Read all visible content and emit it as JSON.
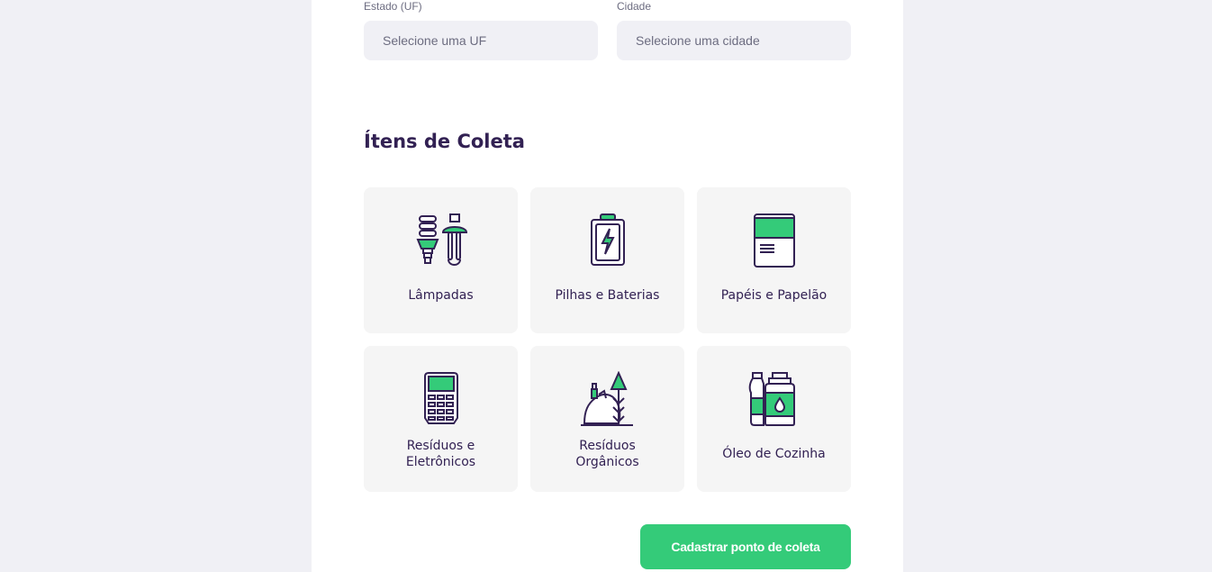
{
  "form": {
    "uf_label": "Estado (UF)",
    "uf_placeholder": "Selecione uma UF",
    "city_label": "Cidade",
    "city_placeholder": "Selecione uma cidade"
  },
  "items_section": {
    "title": "Ítens de Coleta",
    "items": [
      {
        "label": "Lâmpadas",
        "icon": "lamps-icon"
      },
      {
        "label": "Pilhas e Baterias",
        "icon": "battery-icon"
      },
      {
        "label": "Papéis e Papelão",
        "icon": "paper-icon"
      },
      {
        "label": "Resíduos e Eletrônicos",
        "icon": "electronics-icon"
      },
      {
        "label": "Resíduos Orgânicos",
        "icon": "organic-waste-icon"
      },
      {
        "label": "Óleo de Cozinha",
        "icon": "cooking-oil-icon"
      }
    ]
  },
  "submit_label": "Cadastrar ponto de coleta",
  "colors": {
    "primary": "#34cb79",
    "title": "#322153",
    "text": "#6c6c80",
    "background": "#f0f0f5"
  }
}
